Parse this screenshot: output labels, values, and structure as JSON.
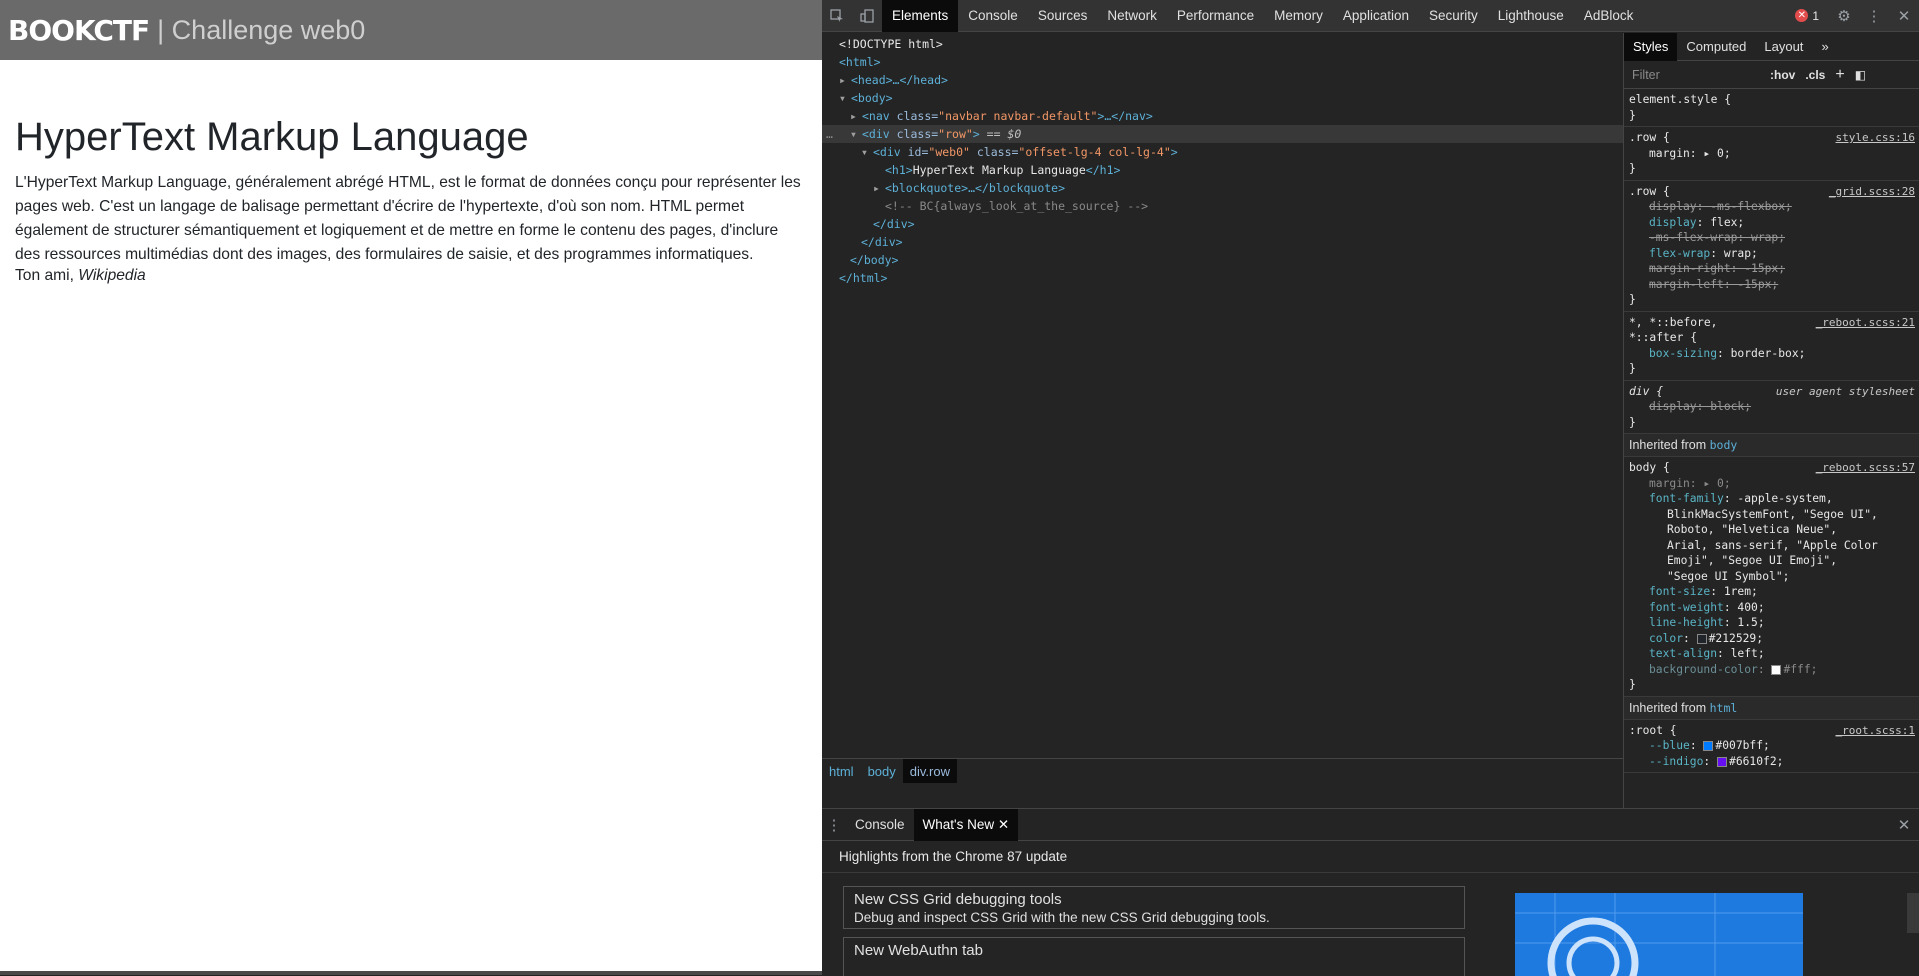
{
  "page": {
    "brand": "BOOKCTF",
    "brand_sub": "| Challenge web0",
    "heading": "HyperText Markup Language",
    "paragraph": "L'HyperText Markup Language, généralement abrégé HTML, est le format de données conçu pour représenter les pages web. C'est un langage de balisage permettant d'écrire de l'hypertexte, d'où son nom. HTML permet également de structurer sémantiquement et logiquement et de mettre en forme le contenu des pages, d'inclure des ressources multimédias dont des images, des formulaires de saisie, et des programmes informatiques.",
    "author_prefix": "Ton ami, ",
    "author_name": "Wikipedia"
  },
  "devtools": {
    "tabs": [
      "Elements",
      "Console",
      "Sources",
      "Network",
      "Performance",
      "Memory",
      "Application",
      "Security",
      "Lighthouse",
      "AdBlock"
    ],
    "active_tab": "Elements",
    "error_count": "1",
    "dom": {
      "doctype": "<!DOCTYPE html>",
      "html_open": "<html>",
      "head": "<head>…</head>",
      "body_open": "<body>",
      "nav_tag": "<nav ",
      "nav_attr": "class=",
      "nav_val": "\"navbar navbar-default\"",
      "nav_close": ">…</nav>",
      "div_row_tag": "<div ",
      "div_row_attr": "class=",
      "div_row_val": "\"row\"",
      "div_row_close": ">",
      "div_row_suffix": " == $0",
      "div_web0_tag": "<div ",
      "div_web0_attr_id": "id=",
      "div_web0_val_id": "\"web0\"",
      "div_web0_attr_class": " class=",
      "div_web0_val_class": "\"offset-lg-4 col-lg-4\"",
      "div_web0_close": ">",
      "h1_open": "<h1>",
      "h1_text": "HyperText Markup Language",
      "h1_close": "</h1>",
      "blockquote": "<blockquote>…</blockquote>",
      "comment": "<!-- BC{always_look_at_the_source} -->",
      "div_close_inner": "</div>",
      "div_close_outer": "</div>",
      "body_close": "</body>",
      "html_close": "</html>"
    },
    "breadcrumbs": [
      "html",
      "body",
      "div.row"
    ],
    "styles": {
      "tabs": [
        "Styles",
        "Computed",
        "Layout"
      ],
      "filter_placeholder": "Filter",
      "hov": ":hov",
      "cls": ".cls",
      "element_style": "element.style {",
      "rules": {
        "row1_sel": ".row {",
        "row1_src": "style.css:16",
        "row1_decl": "margin: ▸ 0;",
        "row2_sel": ".row {",
        "row2_src": "_grid.scss:28",
        "row2_d1": "display: -ms-flexbox;",
        "row2_d2_prop": "display",
        "row2_d2_val": ": flex;",
        "row2_d3": "-ms-flex-wrap: wrap;",
        "row2_d4_prop": "flex-wrap",
        "row2_d4_val": ": wrap;",
        "row2_d5": "margin-right: -15px;",
        "row2_d6": "margin-left: -15px;",
        "univ_sel": "*, *::before,",
        "univ_sel2": "*::after {",
        "univ_src": "_reboot.scss:21",
        "univ_prop": "box-sizing",
        "univ_val": ": border-box;",
        "div_sel": "div {",
        "div_src": "user agent stylesheet",
        "div_decl": "display: block;",
        "inh_body_label": "Inherited from ",
        "inh_body_tag": "body",
        "body_sel": "body {",
        "body_src": "_reboot.scss:57",
        "body_margin": "margin: ▸ 0;",
        "body_ff_prop": "font-family",
        "body_ff_val1": ": -apple-system,",
        "body_ff_val2": "BlinkMacSystemFont, \"Segoe UI\",",
        "body_ff_val3": "Roboto, \"Helvetica Neue\",",
        "body_ff_val4": "Arial, sans-serif, \"Apple Color",
        "body_ff_val5": "Emoji\", \"Segoe UI Emoji\",",
        "body_ff_val6": "\"Segoe UI Symbol\";",
        "body_fs_prop": "font-size",
        "body_fs_val": ": 1rem;",
        "body_fw_prop": "font-weight",
        "body_fw_val": ": 400;",
        "body_lh_prop": "line-height",
        "body_lh_val": ": 1.5;",
        "body_color_prop": "color",
        "body_color_val": "#212529;",
        "body_ta_prop": "text-align",
        "body_ta_val": ": left;",
        "body_bg_prop": "background-color",
        "body_bg_val": "#fff;",
        "inh_html_label": "Inherited from ",
        "inh_html_tag": "html",
        "root_sel": ":root {",
        "root_src": "_root.scss:1",
        "root_blue_prop": "--blue",
        "root_blue_val": "#007bff;",
        "root_indigo_prop": "--indigo",
        "root_indigo_val": "#6610f2;"
      }
    },
    "drawer": {
      "tabs": [
        "Console",
        "What's New"
      ],
      "active_tab": "What's New",
      "highlights": "Highlights from the Chrome 87 update",
      "card1_title": "New CSS Grid debugging tools",
      "card1_desc": "Debug and inspect CSS Grid with the new CSS Grid debugging tools.",
      "card2_title": "New WebAuthn tab"
    },
    "colors": {
      "blue_swatch": "#007bff",
      "indigo_swatch": "#6610f2",
      "text_swatch": "#212529",
      "bg_swatch": "#ffffff"
    }
  }
}
